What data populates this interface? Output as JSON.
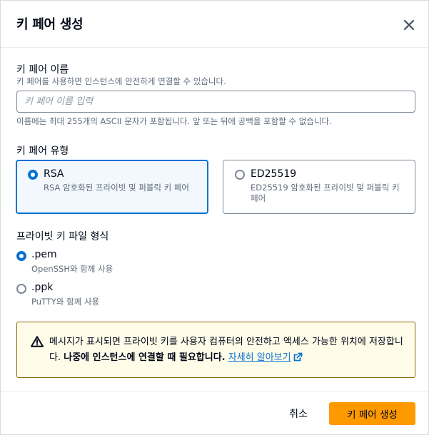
{
  "dialog": {
    "title": "키 페어 생성",
    "close_icon": "close-icon"
  },
  "name_field": {
    "label": "키 페어 이름",
    "description": "키 페어를 사용하면 인스턴스에 안전하게 연결할 수 있습니다.",
    "placeholder": "키 페어 이름 입력",
    "value": "",
    "constraint": "이름에는 최대 255개의 ASCII 문자가 포함됩니다. 앞 또는 뒤에 공백을 포함할 수 없습니다."
  },
  "key_type": {
    "label": "키 페어 유형",
    "selected": "RSA",
    "options": [
      {
        "title": "RSA",
        "description": "RSA 암호화된 프라이빗 및 퍼블릭 키 페어"
      },
      {
        "title": "ED25519",
        "description": "ED25519 암호화된 프라이빗 및 퍼블릭 키 페어"
      }
    ]
  },
  "file_format": {
    "label": "프라이빗 키 파일 형식",
    "selected": ".pem",
    "options": [
      {
        "title": ".pem",
        "description": "OpenSSH와 함께 사용"
      },
      {
        "title": ".ppk",
        "description": "PuTTY와 함께 사용"
      }
    ]
  },
  "alert": {
    "icon": "warning-icon",
    "text": "메시지가 표시되면 프라이빗 키를 사용자 컴퓨터의 안전하고 액세스 가능한 위치에 저장합니다.",
    "bold_text": "나중에 인스턴스에 연결할 때 필요합니다.",
    "link_label": "자세히 알아보기",
    "link_icon": "external-link-icon"
  },
  "footer": {
    "cancel_label": "취소",
    "create_label": "키 페어 생성"
  },
  "colors": {
    "accent": "#0972d3",
    "primary_button": "#ff9900",
    "warning_border": "#8d6605",
    "warning_bg": "#fffce9"
  }
}
